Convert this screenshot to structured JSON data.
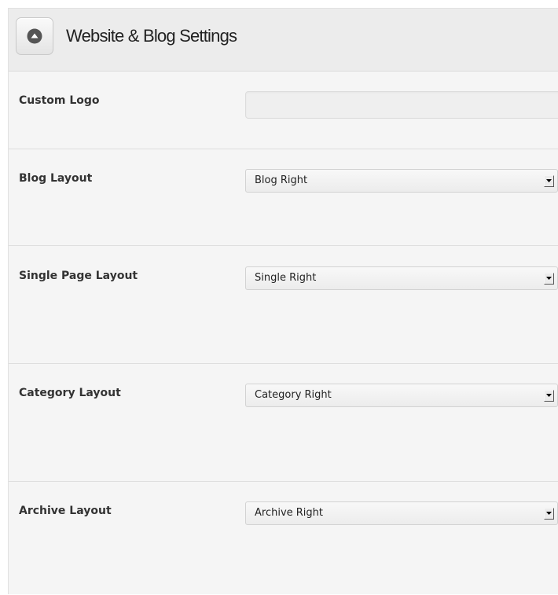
{
  "header": {
    "title": "Website & Blog Settings",
    "toggle_icon": "collapse-up-icon"
  },
  "fields": {
    "custom_logo": {
      "label": "Custom Logo",
      "value": ""
    },
    "blog_layout": {
      "label": "Blog Layout",
      "value": "Blog Right"
    },
    "single_page_layout": {
      "label": "Single Page Layout",
      "value": "Single Right"
    },
    "category_layout": {
      "label": "Category Layout",
      "value": "Category Right"
    },
    "archive_layout": {
      "label": "Archive Layout",
      "value": "Archive Right"
    }
  },
  "icons": {
    "select_arrow": "chevron-down-icon"
  }
}
